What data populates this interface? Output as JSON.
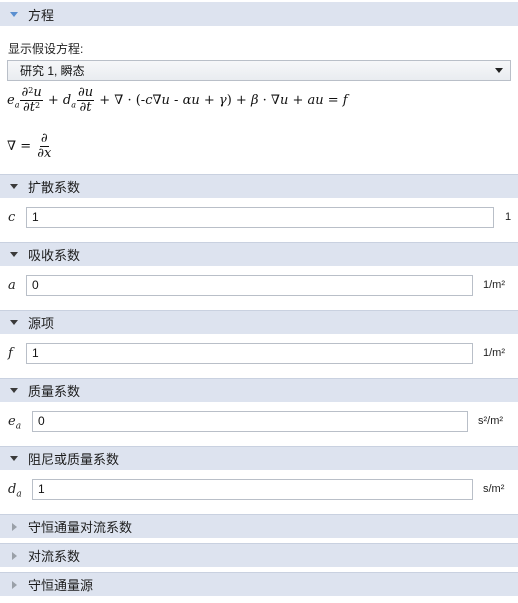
{
  "equation_section": {
    "title": "方程",
    "show_label": "显示假设方程:",
    "study_selected": "研究 1, 瞬态"
  },
  "equations": {
    "main": "e_a ∂²u/∂t² + d_a ∂u/∂t + ∇·(-c∇u - αu + γ) + β·∇u + au = f",
    "nabla": "∇ = ∂/∂x"
  },
  "sections": [
    {
      "title": "扩散系数",
      "expanded": true,
      "symbol": "c",
      "value": "1",
      "unit": "1"
    },
    {
      "title": "吸收系数",
      "expanded": true,
      "symbol": "a",
      "value": "0",
      "unit": "1/m²"
    },
    {
      "title": "源项",
      "expanded": true,
      "symbol": "f",
      "value": "1",
      "unit": "1/m²"
    },
    {
      "title": "质量系数",
      "expanded": true,
      "symbol": "e",
      "symbol_sub": "a",
      "value": "0",
      "unit": "s²/m²"
    },
    {
      "title": "阻尼或质量系数",
      "expanded": true,
      "symbol": "d",
      "symbol_sub": "a",
      "value": "1",
      "unit": "s/m²"
    },
    {
      "title": "守恒通量对流系数",
      "expanded": false
    },
    {
      "title": "对流系数",
      "expanded": false
    },
    {
      "title": "守恒通量源",
      "expanded": false
    }
  ]
}
